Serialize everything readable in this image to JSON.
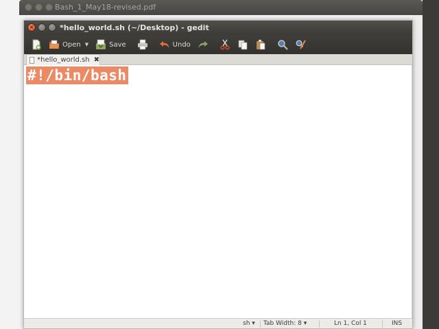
{
  "background_window": {
    "title": "Bash_1_May18-revised.pdf"
  },
  "window": {
    "title": "*hello_world.sh (~/Desktop) - gedit"
  },
  "toolbar": {
    "open_label": "Open",
    "save_label": "Save",
    "undo_label": "Undo"
  },
  "tabs": [
    {
      "label": "*hello_world.sh"
    }
  ],
  "editor": {
    "lines": [
      "#!/bin/bash"
    ],
    "selection_color": "#ec8a66"
  },
  "statusbar": {
    "language": "sh",
    "tab_width": "Tab Width: 8",
    "position": "Ln 1, Col 1",
    "mode": "INS"
  },
  "colors": {
    "toolbar_bg": "#3c3b37",
    "accent_close": "#df4a13"
  }
}
